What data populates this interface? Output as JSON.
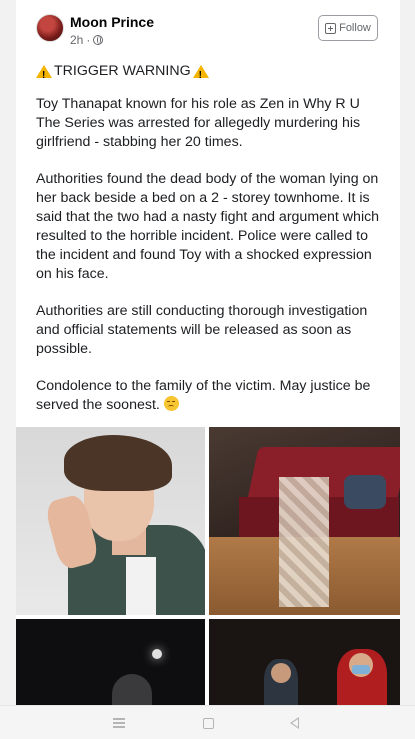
{
  "post": {
    "author": "Moon Prince",
    "time": "2h",
    "visibility_icon": "globe-icon",
    "follow_label": "Follow",
    "trigger_warning": "TRIGGER WARNING",
    "paragraphs": [
      "Toy Thanapat known for his role as Zen in Why R U The Series was arrested for allegedly murdering his girlfriend - stabbing her 20 times.",
      "Authorities found the dead body of the woman lying on her back beside a bed on a 2 - storey townhome. It is said that the two had a nasty fight and argument which resulted to the horrible incident. Police were called to the incident and found Toy with a shocked expression on his face.",
      "Authorities are still conducting thorough investigation and official statements will be released as soon as possible.",
      "Condolence to the family of the victim. May justice be served the soonest."
    ]
  },
  "colors": {
    "author_text": "#050505",
    "meta_text": "#65676b",
    "warning_yellow": "#f4b400",
    "bed_red": "#8a1f2a"
  },
  "navbar": {
    "icons": [
      "menu-icon",
      "home-icon",
      "back-icon"
    ]
  }
}
